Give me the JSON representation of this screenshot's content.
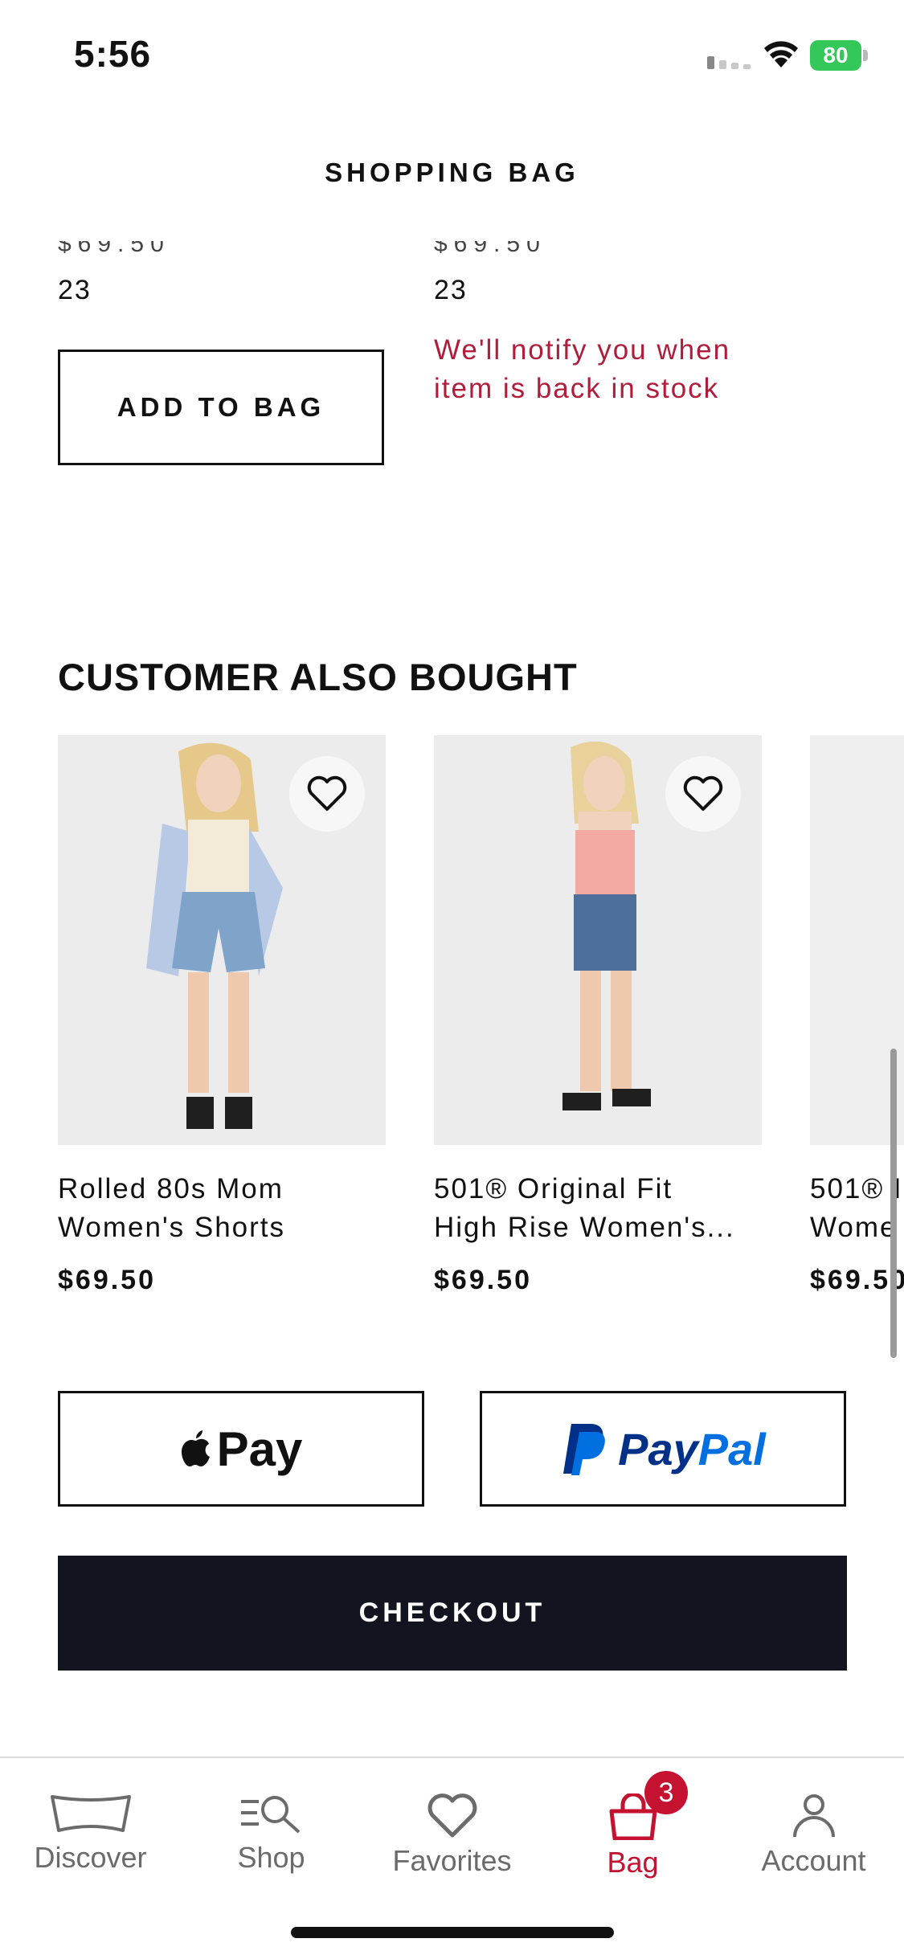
{
  "status_bar": {
    "time": "5:56",
    "battery": "80"
  },
  "header": {
    "title": "SHOPPING BAG"
  },
  "saved_items": [
    {
      "price_clipped": "$69.50",
      "size": "23",
      "action_label": "ADD TO BAG"
    },
    {
      "price_clipped": "$69.50",
      "size": "23",
      "notice": "We'll notify you when item is back in stock"
    }
  ],
  "recommendations": {
    "title": "CUSTOMER ALSO BOUGHT",
    "products": [
      {
        "name_line1": "Rolled 80s Mom",
        "name_line2": "Women's Shorts",
        "price": "$69.50"
      },
      {
        "name_line1": "501® Original Fit",
        "name_line2": "High Rise Women's...",
        "price": "$69.50"
      },
      {
        "name_line1": "501® I",
        "name_line2": "Wome",
        "price": "$69.50"
      }
    ]
  },
  "payment": {
    "apple_pay_label": "Pay",
    "paypal_label": "PayPal",
    "checkout_label": "CHECKOUT"
  },
  "tabs": [
    {
      "label": "Discover",
      "icon": "jeans-icon"
    },
    {
      "label": "Shop",
      "icon": "search-list-icon"
    },
    {
      "label": "Favorites",
      "icon": "heart-icon"
    },
    {
      "label": "Bag",
      "icon": "bag-icon",
      "active": true,
      "badge": "3"
    },
    {
      "label": "Account",
      "icon": "person-icon"
    }
  ],
  "colors": {
    "accent_red": "#c41230",
    "notice_red": "#b01c3a",
    "checkout_bg": "#12151f",
    "paypal_dark": "#003087",
    "paypal_light": "#0070e0"
  }
}
